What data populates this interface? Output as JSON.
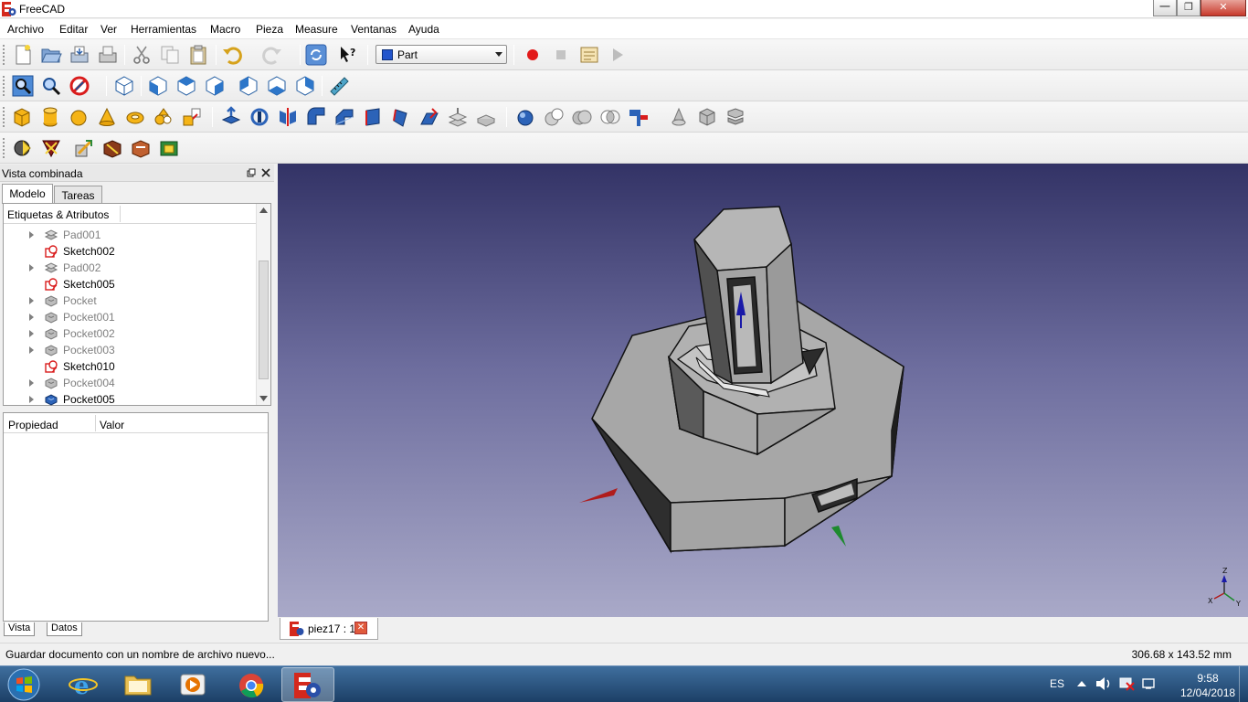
{
  "window": {
    "title": "FreeCAD"
  },
  "menubar": [
    "Archivo",
    "Editar",
    "Ver",
    "Herramientas",
    "Macro",
    "Pieza",
    "Measure",
    "Ventanas",
    "Ayuda"
  ],
  "toolbar": {
    "workbench": "Part"
  },
  "combo_view": {
    "title": "Vista combinada",
    "tabs": [
      "Modelo",
      "Tareas"
    ],
    "tree_header": "Etiquetas & Atributos",
    "tree_items": [
      {
        "label": "Pad001",
        "type": "pad",
        "dim": true,
        "expandable": true
      },
      {
        "label": "Sketch002",
        "type": "sketch",
        "dim": false,
        "expandable": false
      },
      {
        "label": "Pad002",
        "type": "pad",
        "dim": true,
        "expandable": true
      },
      {
        "label": "Sketch005",
        "type": "sketch",
        "dim": false,
        "expandable": false
      },
      {
        "label": "Pocket",
        "type": "pocket",
        "dim": true,
        "expandable": true
      },
      {
        "label": "Pocket001",
        "type": "pocket",
        "dim": true,
        "expandable": true
      },
      {
        "label": "Pocket002",
        "type": "pocket",
        "dim": true,
        "expandable": true
      },
      {
        "label": "Pocket003",
        "type": "pocket",
        "dim": true,
        "expandable": true
      },
      {
        "label": "Sketch010",
        "type": "sketch",
        "dim": false,
        "expandable": false
      },
      {
        "label": "Pocket004",
        "type": "pocket",
        "dim": true,
        "expandable": true
      },
      {
        "label": "Pocket005",
        "type": "pocket-active",
        "dim": false,
        "expandable": true
      }
    ],
    "property_headers": [
      "Propiedad",
      "Valor"
    ],
    "bottom_tabs": [
      "Vista",
      "Datos"
    ]
  },
  "document_tab": {
    "label": "piez17 : 1"
  },
  "axis_labels": [
    "Z",
    "X",
    "Y"
  ],
  "status": {
    "message": "Guardar documento con un nombre de archivo nuevo...",
    "dimensions": "306.68 x 143.52 mm"
  },
  "taskbar": {
    "language": "ES",
    "time": "9:58",
    "date": "12/04/2018"
  },
  "colors": {
    "viewport_top": "#333366",
    "viewport_bottom": "#a9a9c8",
    "model_face": "#a6a6a6",
    "axis_x": "#b01c1c",
    "axis_y": "#1d8a2e",
    "axis_z": "#1a1aa8"
  }
}
